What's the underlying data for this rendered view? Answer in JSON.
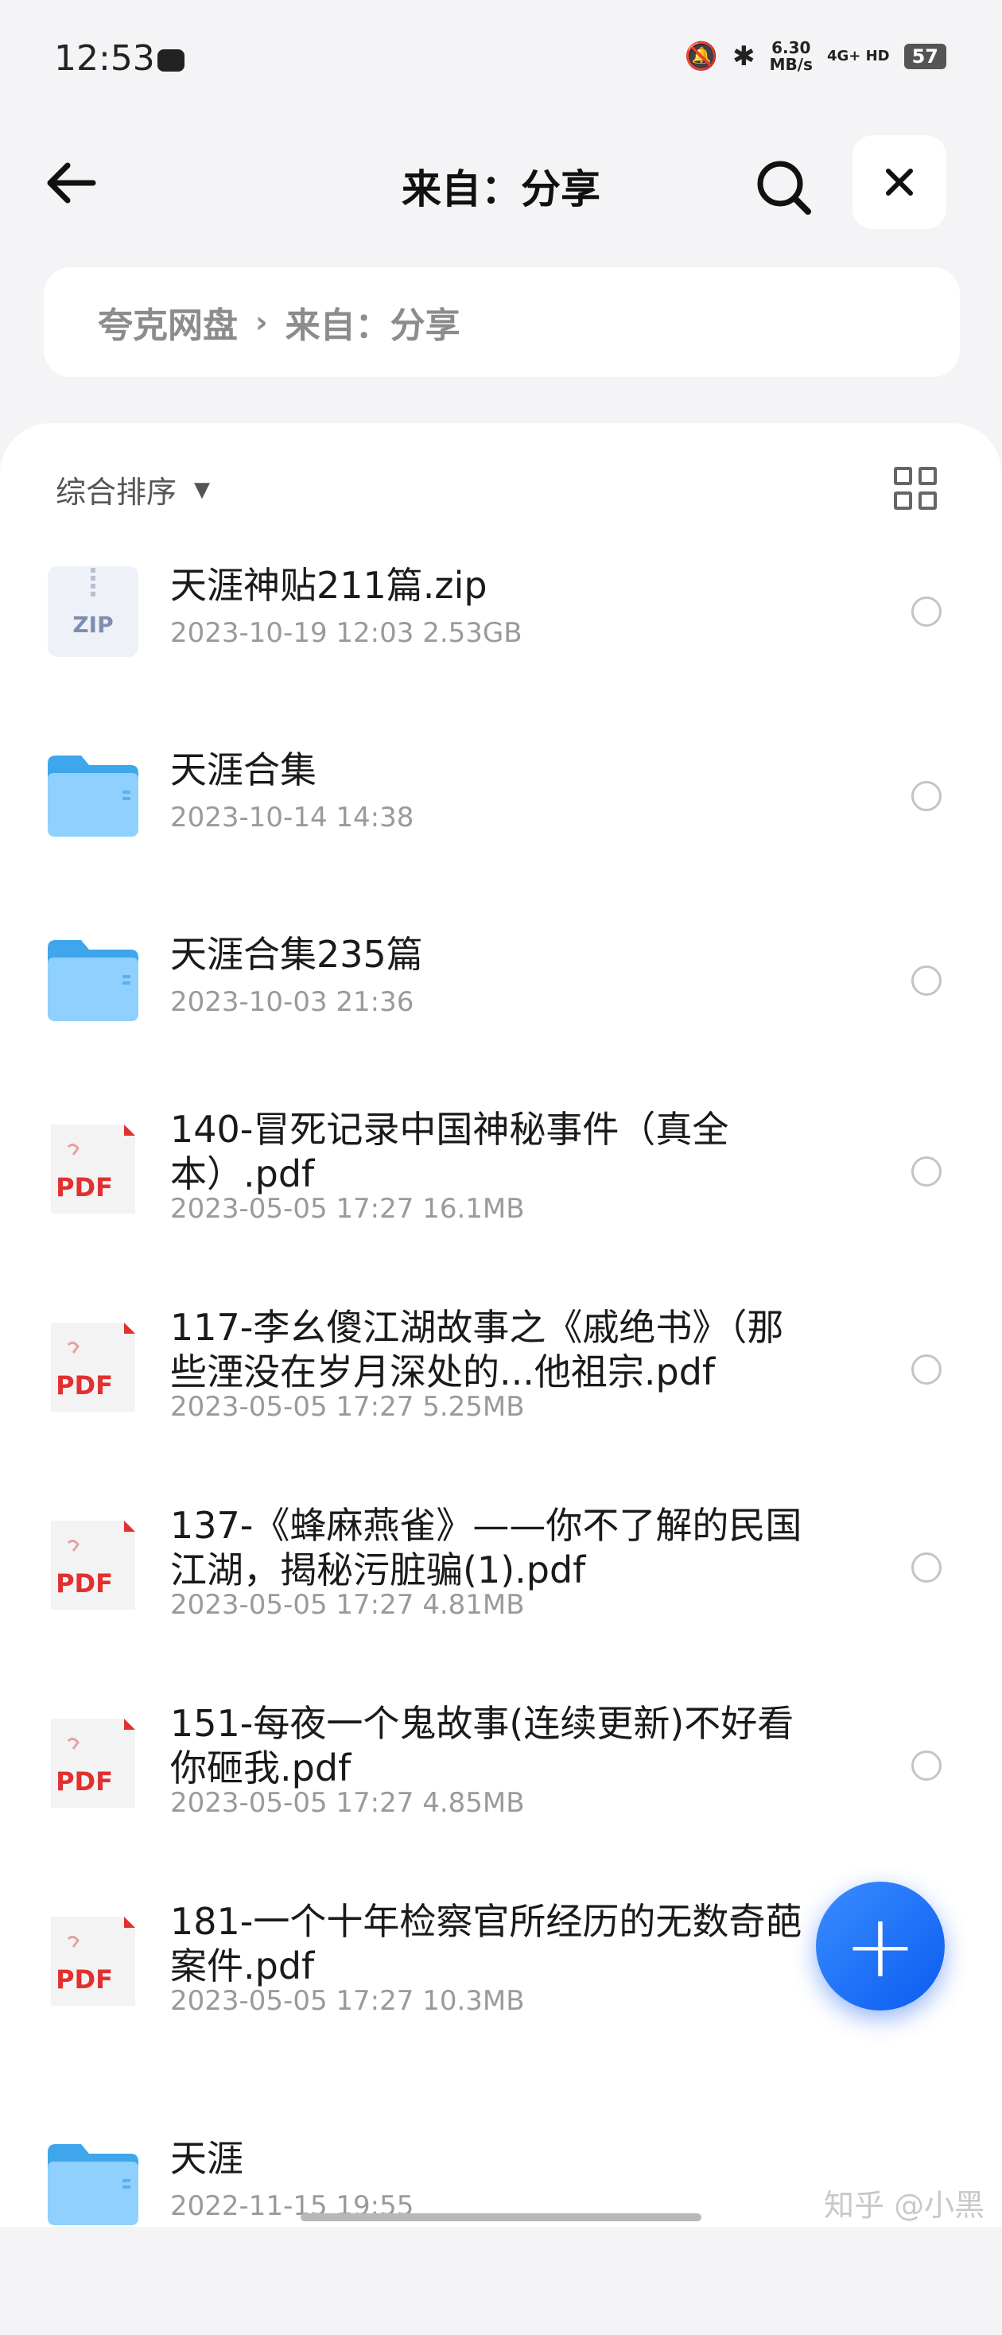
{
  "status_bar": {
    "time": "12:53",
    "net_speed_value": "6.30",
    "net_speed_unit": "MB/s",
    "net_type_top": "4G+ HD",
    "battery": "57"
  },
  "header": {
    "title": "来自：分享",
    "back_icon": "arrow-left-icon",
    "search_icon": "search-icon",
    "close_icon": "close-icon"
  },
  "breadcrumb": {
    "root": "夸克网盘",
    "separator": "›",
    "current": "来自：分享"
  },
  "sort_bar": {
    "label": "综合排序",
    "caret": "▼"
  },
  "files": [
    {
      "name": "天涯神贴211篇.zip",
      "meta": "2023-10-19 12:03  2.53GB",
      "type": "zip"
    },
    {
      "name": "天涯合集",
      "meta": "2023-10-14 14:38",
      "type": "folder"
    },
    {
      "name": "天涯合集235篇",
      "meta": "2023-10-03 21:36",
      "type": "folder"
    },
    {
      "name": "140-冒死记录中国神秘事件（真全本）.pdf",
      "meta": "2023-05-05 17:27  16.1MB",
      "type": "pdf"
    },
    {
      "name": "117-李幺傻江湖故事之《戚绝书》（那些湮没在岁月深处的...他祖宗.pdf",
      "meta": "2023-05-05 17:27  5.25MB",
      "type": "pdf"
    },
    {
      "name": "137-《蜂麻燕雀》——你不了解的民国江湖，揭秘污脏骗(1).pdf",
      "meta": "2023-05-05 17:27  4.81MB",
      "type": "pdf"
    },
    {
      "name": "151-每夜一个鬼故事(连续更新)不好看你砸我.pdf",
      "meta": "2023-05-05 17:27  4.85MB",
      "type": "pdf"
    },
    {
      "name": "181-一个十年检察官所经历的无数奇葩案件.pdf",
      "meta": "2023-05-05 17:27  10.3MB",
      "type": "pdf"
    },
    {
      "name": "天涯",
      "meta": "2022-11-15 19:55",
      "type": "folder"
    }
  ],
  "icon_labels": {
    "zip": "ZIP",
    "pdf": "PDF"
  },
  "fab": {
    "label": "+"
  },
  "watermark": "知乎 @小黑"
}
